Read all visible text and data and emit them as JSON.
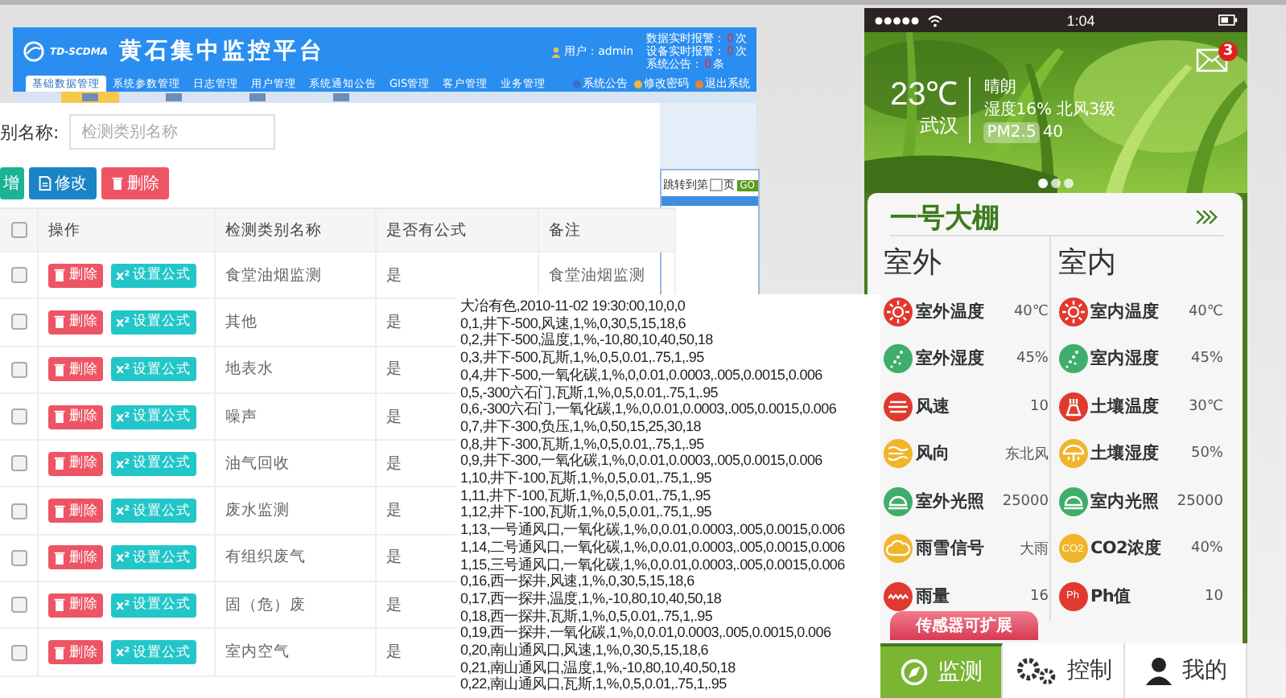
{
  "web_app": {
    "logo": "TD-SCDMA",
    "title": "黄石集中监控平台",
    "user": "用户：admin",
    "alerts": [
      {
        "label": "数据实时报警：",
        "count": "0",
        "unit": "次"
      },
      {
        "label": "设备实时报警：",
        "count": "0",
        "unit": "次"
      },
      {
        "label": "系统公告：",
        "count": "0",
        "unit": "条"
      }
    ],
    "nav": [
      {
        "label": "基础数据管理",
        "selected": true
      },
      {
        "label": "系统参数管理",
        "selected": false
      },
      {
        "label": "日志管理",
        "selected": false
      },
      {
        "label": "用户管理",
        "selected": false
      },
      {
        "label": "系统通知公告",
        "selected": false
      },
      {
        "label": "GIS管理",
        "selected": false
      },
      {
        "label": "客户管理",
        "selected": false
      },
      {
        "label": "业务管理",
        "selected": false
      }
    ],
    "links": [
      {
        "label": "系统公告",
        "color": "#3a6fc4"
      },
      {
        "label": "修改密码",
        "color": "#f2b632"
      },
      {
        "label": "退出系统",
        "color": "#f07f2a"
      }
    ],
    "toolbar": [
      {
        "selected": true
      },
      {
        "selected": false
      },
      {
        "selected": false
      },
      {
        "selected": false
      }
    ],
    "pager": {
      "jump_label": "跳转到第",
      "unit": "页",
      "go": "GO"
    },
    "search": {
      "label": "别名称:",
      "placeholder": "检测类别名称"
    },
    "actions": [
      {
        "kind": "add",
        "label": "增"
      },
      {
        "kind": "edit",
        "label": "修改"
      },
      {
        "kind": "delete",
        "label": "删除"
      }
    ],
    "table": {
      "all_checked": false,
      "columns": [
        "操作",
        "检测类别名称",
        "是否有公式",
        "备注"
      ],
      "rows": [
        {
          "checked": false,
          "delete": "删除",
          "formula_icon": "x²",
          "formula": "设置公式",
          "name": "食堂油烟监测",
          "has_formula": "是",
          "note": "食堂油烟监测"
        },
        {
          "checked": false,
          "delete": "删除",
          "formula_icon": "x²",
          "formula": "设置公式",
          "name": "其他",
          "has_formula": "是"
        },
        {
          "checked": false,
          "delete": "删除",
          "formula_icon": "x²",
          "formula": "设置公式",
          "name": "地表水",
          "has_formula": "是"
        },
        {
          "checked": false,
          "delete": "删除",
          "formula_icon": "x²",
          "formula": "设置公式",
          "name": "噪声",
          "has_formula": "是"
        },
        {
          "checked": false,
          "delete": "删除",
          "formula_icon": "x²",
          "formula": "设置公式",
          "name": "油气回收",
          "has_formula": "是"
        },
        {
          "checked": false,
          "delete": "删除",
          "formula_icon": "x²",
          "formula": "设置公式",
          "name": "废水监测",
          "has_formula": "是"
        },
        {
          "checked": false,
          "delete": "删除",
          "formula_icon": "x²",
          "formula": "设置公式",
          "name": "有组织废气",
          "has_formula": "是"
        },
        {
          "checked": false,
          "delete": "删除",
          "formula_icon": "x²",
          "formula": "设置公式",
          "name": "固（危）废",
          "has_formula": "是"
        },
        {
          "checked": false,
          "delete": "删除",
          "formula_icon": "x²",
          "formula": "设置公式",
          "name": "室内空气",
          "has_formula": "是"
        }
      ]
    }
  },
  "text_file": {
    "lines": [
      "大冶有色,2010-11-02 19:30:00,10,0,0",
      "0,1,井下-500,风速,1,%,0,30,5,15,18,6",
      "0,2,井下-500,温度,1,%,-10,80,10,40,50,18",
      "0,3,井下-500,瓦斯,1,%,0,5,0.01,.75,1,.95",
      "0,4,井下-500,一氧化碳,1,%,0,0.01,0.0003,.005,0.0015,0.006",
      "0,5,-300六石门,瓦斯,1,%,0,5,0.01,.75,1,.95",
      "0,6,-300六石门,一氧化碳,1,%,0,0.01,0.0003,.005,0.0015,0.006",
      "0,7,井下-300,负压,1,%,0,50,15,25,30,18",
      "0,8,井下-300,瓦斯,1,%,0,5,0.01,.75,1,.95",
      "0,9,井下-300,一氧化碳,1,%,0,0.01,0.0003,.005,0.0015,0.006",
      "1,10,井下-100,瓦斯,1,%,0,5,0.01,.75,1,.95",
      "1,11,井下-100,瓦斯,1,%,0,5,0.01,.75,1,.95",
      "1,12,井下-100,瓦斯,1,%,0,5,0.01,.75,1,.95",
      "1,13,一号通风口,一氧化碳,1,%,0,0.01,0.0003,.005,0.0015,0.006",
      "1,14,二号通风口,一氧化碳,1,%,0,0.01,0.0003,.005,0.0015,0.006",
      "1,15,三号通风口,一氧化碳,1,%,0,0.01,0.0003,.005,0.0015,0.006",
      "0,16,西一探井,风速,1,%,0,30,5,15,18,6",
      "0,17,西一探井,温度,1,%,-10,80,10,40,50,18",
      "0,18,西一探井,瓦斯,1,%,0,5,0.01,.75,1,.95",
      "0,19,西一探井,一氧化碳,1,%,0,0.01,0.0003,.005,0.0015,0.006",
      "0,20,南山通风口,风速,1,%,0,30,5,15,18,6",
      "0,21,南山通风口,温度,1,%,-10,80,10,40,50,18",
      "0,22,南山通风口,瓦斯,1,%,0,5,0.01,.75,1,.95"
    ]
  },
  "phone": {
    "time": "1:04",
    "mail_badge": "3",
    "weather": {
      "temperature": "23℃",
      "city": "武汉",
      "condition": "晴朗",
      "detail": "湿度16% 北风3级",
      "pm_label": "PM2.5",
      "pm_value": "40"
    },
    "pages": [
      {
        "selected": true
      },
      {
        "selected": false
      },
      {
        "selected": false
      }
    ],
    "card": {
      "title": "一号大棚",
      "columns": [
        {
          "heading": "室外",
          "sensors": [
            {
              "kind": "sun",
              "label": "室外温度",
              "value": "40℃",
              "color": "#e0392f"
            },
            {
              "kind": "drops",
              "label": "室外湿度",
              "value": "45%",
              "color": "#3fae6a"
            },
            {
              "kind": "wind",
              "label": "风速",
              "value": "10",
              "color": "#e0392f"
            },
            {
              "kind": "wave",
              "label": "风向",
              "value": "东北风",
              "color": "#f0b52a"
            },
            {
              "kind": "lamp",
              "label": "室外光照",
              "value": "25000",
              "color": "#3fae6a"
            },
            {
              "kind": "cloud",
              "label": "雨雪信号",
              "value": "大雨",
              "color": "#f0b52a"
            },
            {
              "kind": "rain",
              "label": "雨量",
              "value": "16",
              "color": "#e0392f"
            }
          ]
        },
        {
          "heading": "室内",
          "sensors": [
            {
              "kind": "sun",
              "label": "室内温度",
              "value": "40℃",
              "color": "#e0392f"
            },
            {
              "kind": "drops",
              "label": "室内湿度",
              "value": "45%",
              "color": "#3fae6a"
            },
            {
              "kind": "soil",
              "label": "土壤温度",
              "value": "30℃",
              "color": "#e0392f"
            },
            {
              "kind": "umbrella",
              "label": "土壤湿度",
              "value": "50%",
              "color": "#f0b52a"
            },
            {
              "kind": "lamp",
              "label": "室内光照",
              "value": "25000",
              "color": "#3fae6a"
            },
            {
              "kind": "text",
              "icon_text": "CO2",
              "label": "CO2浓度",
              "value": "40%",
              "color": "#f0b52a"
            },
            {
              "kind": "text",
              "icon_text": "Ph",
              "label": "Ph值",
              "value": "10",
              "color": "#e0392f"
            }
          ]
        }
      ]
    },
    "expand_button": "传感器可扩展",
    "tabs": [
      {
        "kind": "compass",
        "label": "监测",
        "selected": true
      },
      {
        "kind": "gears",
        "label": "控制",
        "selected": false
      },
      {
        "kind": "person",
        "label": "我的",
        "selected": false
      }
    ]
  }
}
